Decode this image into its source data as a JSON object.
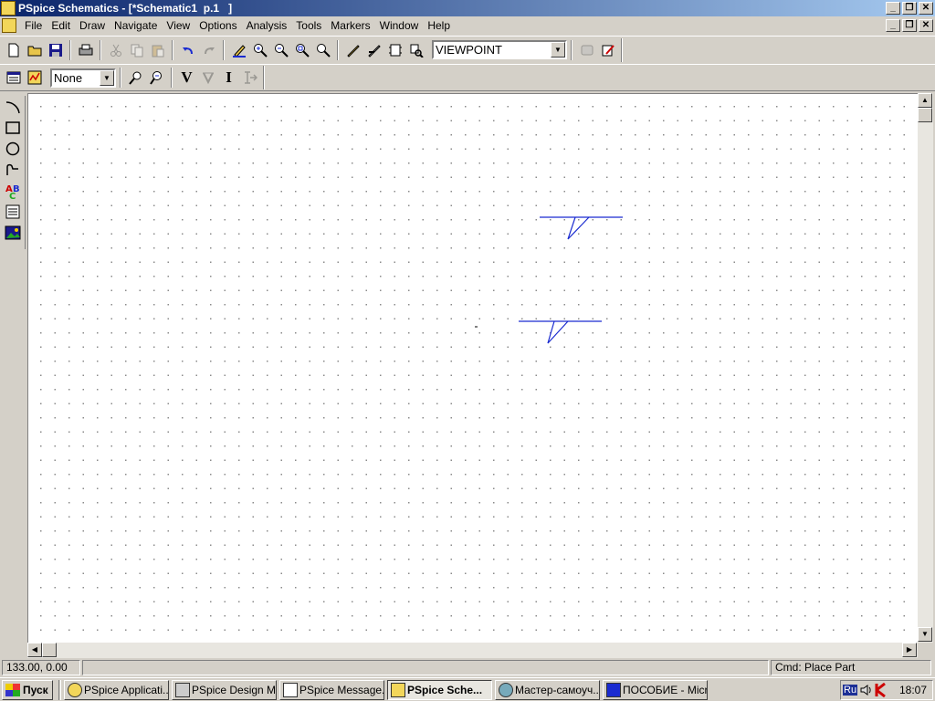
{
  "window": {
    "title": "PSpice Schematics - [*Schematic1  p.1   ]",
    "controls": [
      "_",
      "❐",
      "✕"
    ]
  },
  "menu": {
    "items": [
      {
        "label": "File"
      },
      {
        "label": "Edit"
      },
      {
        "label": "Draw"
      },
      {
        "label": "Navigate"
      },
      {
        "label": "View"
      },
      {
        "label": "Options"
      },
      {
        "label": "Analysis"
      },
      {
        "label": "Tools"
      },
      {
        "label": "Markers"
      },
      {
        "label": "Window"
      },
      {
        "label": "Help"
      }
    ]
  },
  "toolbar": {
    "part_combo_value": "VIEWPOINT",
    "style_combo_value": "None",
    "voltage_marker": "V",
    "current_marker": "I"
  },
  "status": {
    "coords": "133.00,  0.00",
    "command": "Cmd: Place Part"
  },
  "taskbar": {
    "start_label": "Пуск",
    "tasks": [
      {
        "label": "PSpice Applicati...",
        "active": false
      },
      {
        "label": "PSpice Design M...",
        "active": false
      },
      {
        "label": "PSpice Message...",
        "active": false
      },
      {
        "label": "PSpice Sche...",
        "active": true
      },
      {
        "label": "Мастер-самоуч...",
        "active": false
      },
      {
        "label": "ПОСОБИЕ - Micr...",
        "active": false
      }
    ],
    "tray": {
      "language": "Ru",
      "clock": "18:07"
    }
  },
  "colors": {
    "title_gradient_start": "#0a246a",
    "title_gradient_end": "#a6caf0",
    "schematic_wire": "#1a2bd0",
    "chrome": "#d4d0c8"
  }
}
